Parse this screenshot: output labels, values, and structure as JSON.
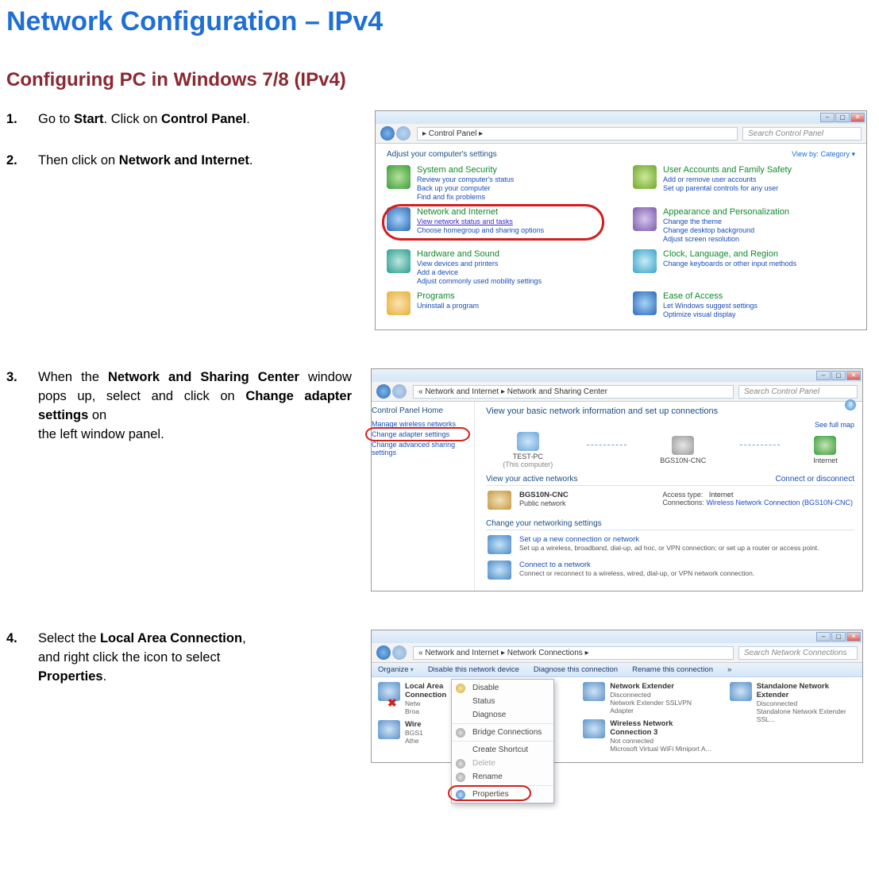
{
  "title": "Network Configuration – IPv4",
  "subtitle": "Configuring PC in Windows 7/8 (IPv4)",
  "steps": {
    "s1": {
      "num": "1.",
      "text_pre": "Go to ",
      "b1": "Start",
      "mid1": ". Click on ",
      "b2": "Control Panel",
      "tail": "."
    },
    "s2": {
      "num": "2.",
      "text_pre": "Then click on ",
      "b1": "Network and Internet",
      "tail": "."
    },
    "s3": {
      "num": "3.",
      "line1_pre": "When  the  ",
      "line1_b": "Network  and  Sharing",
      "line2_b": "Center",
      "line2_mid": "  window  pops  up,  select  and",
      "line3_pre": "click on ",
      "line3_b": "Change adapter settings",
      "line3_tail": " on",
      "line4": "the left window panel."
    },
    "s4": {
      "num": "4.",
      "line1_pre": "Select  the  ",
      "line1_b": "Local  Area  Connection",
      "line1_tail": ",",
      "line2": "and  right  click  the  icon  to  select",
      "line3_b": "Properties",
      "line3_tail": "."
    }
  },
  "win1": {
    "breadcrumb": "▸ Control Panel  ▸",
    "search_ph": "Search Control Panel",
    "adjust": "Adjust your computer's settings",
    "viewby": "View by:   Category ▾",
    "cats": {
      "sys": {
        "t": "System and Security",
        "l1": "Review your computer's status",
        "l2": "Back up your computer",
        "l3": "Find and fix problems"
      },
      "net": {
        "t": "Network and Internet",
        "l1": "View network status and tasks",
        "l2": "Choose homegroup and sharing options"
      },
      "hw": {
        "t": "Hardware and Sound",
        "l1": "View devices and printers",
        "l2": "Add a device",
        "l3": "Adjust commonly used mobility settings"
      },
      "prog": {
        "t": "Programs",
        "l1": "Uninstall a program"
      },
      "user": {
        "t": "User Accounts and Family Safety",
        "l1": "Add or remove user accounts",
        "l2": "Set up parental controls for any user"
      },
      "appr": {
        "t": "Appearance and Personalization",
        "l1": "Change the theme",
        "l2": "Change desktop background",
        "l3": "Adjust screen resolution"
      },
      "clock": {
        "t": "Clock, Language, and Region",
        "l1": "Change keyboards or other input methods"
      },
      "ease": {
        "t": "Ease of Access",
        "l1": "Let Windows suggest settings",
        "l2": "Optimize visual display"
      }
    }
  },
  "win2": {
    "breadcrumb": "« Network and Internet  ▸  Network and Sharing Center",
    "search_ph": "Search Control Panel",
    "side": {
      "home": "Control Panel Home",
      "l1": "Manage wireless networks",
      "l2": "Change adapter settings",
      "l3": "Change advanced sharing settings"
    },
    "help": "?",
    "h1": "View your basic network information and set up connections",
    "fullmap": "See full map",
    "nodes": {
      "a": "TEST-PC",
      "asub": "(This computer)",
      "b": "BGS10N-CNC",
      "c": "Internet"
    },
    "active_title": "View your active networks",
    "active_right": "Connect or disconnect",
    "net": {
      "name": "BGS10N-CNC",
      "type": "Public network",
      "at": "Access type:",
      "atv": "Internet",
      "cn": "Connections:",
      "cnv": "Wireless Network Connection (BGS10N-CNC)"
    },
    "chg_title": "Change your networking settings",
    "c1": {
      "a": "Set up a new connection or network",
      "b": "Set up a wireless, broadband, dial-up, ad hoc, or VPN connection; or set up a router or access point."
    },
    "c2": {
      "a": "Connect to a network",
      "b": "Connect or reconnect to a wireless, wired, dial-up, or VPN network connection."
    }
  },
  "win3": {
    "breadcrumb": "« Network and Internet  ▸  Network Connections  ▸",
    "search_ph": "Search Network Connections",
    "tb": {
      "a": "Organize",
      "b": "Disable this network device",
      "c": "Diagnose this connection",
      "d": "Rename this connection",
      "e": "»"
    },
    "items": {
      "lac": {
        "t": "Local Area Connection",
        "s1": "Netw",
        "s2": "Broa"
      },
      "wnc": {
        "t": "Wire",
        "s1": "BGS1",
        "s2": "Athe"
      },
      "ext": {
        "t": "Network Extender",
        "s1": "Disconnected",
        "s2": "Network Extender SSLVPN Adapter"
      },
      "wnc3": {
        "t": "Wireless Network Connection 3",
        "s1": "Not connected",
        "s2": "Microsoft Virtual WiFi Miniport A..."
      },
      "sne": {
        "t": "Standalone Network Extender",
        "s1": "Disconnected",
        "s2": "Standalone Network Extender SSL..."
      }
    },
    "menu": {
      "disable": "Disable",
      "status": "Status",
      "diagnose": "Diagnose",
      "bridge": "Bridge Connections",
      "shortcut": "Create Shortcut",
      "delete": "Delete",
      "rename": "Rename",
      "properties": "Properties"
    }
  }
}
